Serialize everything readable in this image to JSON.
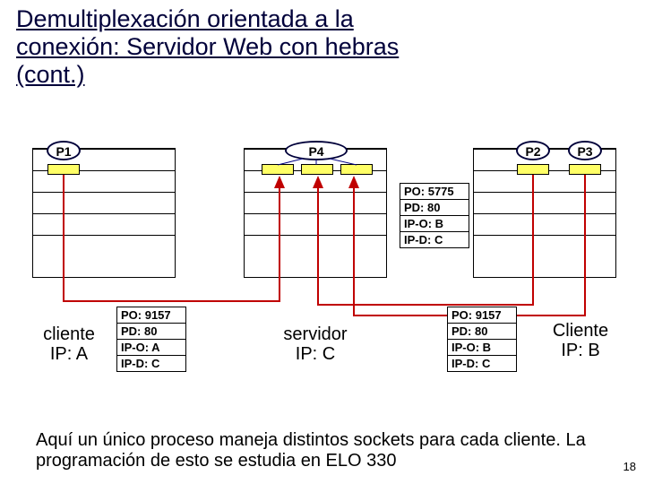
{
  "title_lines": [
    "Demultiplexación orientada a la",
    "conexión: Servidor Web con hebras",
    "(cont.)"
  ],
  "processes": {
    "p1": "P1",
    "p2": "P2",
    "p3": "P3",
    "p4": "P4"
  },
  "packet_left": {
    "po": "PO: 9157",
    "pd": "PD: 80",
    "ipo": "IP-O: A",
    "ipd": "IP-D: C"
  },
  "packet_mid": {
    "po": "PO: 5775",
    "pd": "PD: 80",
    "ipo": "IP-O: B",
    "ipd": "IP-D: C"
  },
  "packet_right": {
    "po": "PO: 9157",
    "pd": "PD: 80",
    "ipo": "IP-O: B",
    "ipd": "IP-D: C"
  },
  "labels": {
    "clientA_l1": "cliente",
    "clientA_l2": "IP: A",
    "server_l1": "servidor",
    "server_l2": "IP: C",
    "clientB_l1": "Cliente",
    "clientB_l2": "IP: B"
  },
  "footnote": "Aquí un único proceso maneja distintos sockets para cada cliente. La programación de esto se estudia en ELO 330",
  "page": "18"
}
